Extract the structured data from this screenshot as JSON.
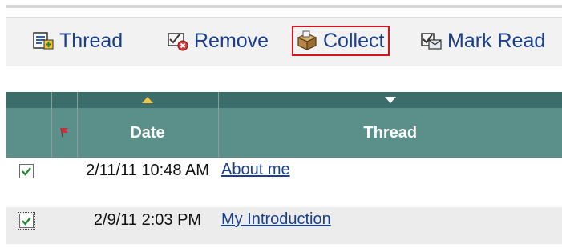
{
  "toolbar": {
    "items": [
      {
        "label": "Thread",
        "icon": "new-thread-icon"
      },
      {
        "label": "Remove",
        "icon": "remove-icon"
      },
      {
        "label": "Collect",
        "icon": "collect-icon",
        "selected": true
      },
      {
        "label": "Mark Read",
        "icon": "mark-read-icon"
      }
    ]
  },
  "table": {
    "columns": [
      {
        "key": "select",
        "label": ""
      },
      {
        "key": "flag",
        "label": "",
        "icon": "flag-icon"
      },
      {
        "key": "date",
        "label": "Date",
        "sort": "ascending"
      },
      {
        "key": "thread",
        "label": "Thread",
        "sort": "descending"
      }
    ],
    "rows": [
      {
        "checked": true,
        "date": "2/11/11 10:48 AM",
        "thread": "About me"
      },
      {
        "checked": true,
        "date": "2/9/11 2:03 PM",
        "thread": "My Introduction"
      }
    ]
  },
  "colors": {
    "header_dark": "#3b6e6a",
    "header": "#5a8f8a",
    "link": "#1a3f8f",
    "selection_border": "#d1151b",
    "flag": "#c8323a",
    "sort_asc_arrow": "#f4c440",
    "sort_desc_arrow": "#ffffff"
  }
}
